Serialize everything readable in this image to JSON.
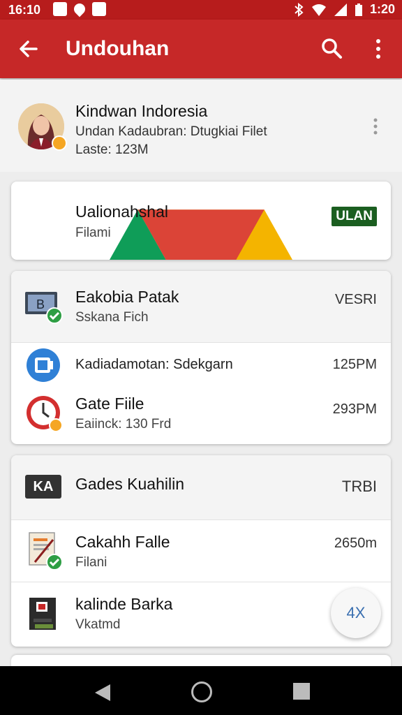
{
  "status": {
    "time": "16:10",
    "time_right": "1:20"
  },
  "appbar": {
    "title": "Undouhan"
  },
  "profile": {
    "name": "Kindwan Indoresia",
    "subtitle": "Undan Kadaubran: Dtugkiai Filet",
    "size": "Laste: 123M"
  },
  "card1": {
    "title": "Ualionahshal",
    "subtitle": "Filami",
    "badge": "ULAN"
  },
  "card2": {
    "header": {
      "title": "Eakobia Patak",
      "subtitle": "Sskana Fich",
      "right": "VESRI"
    },
    "rows": [
      {
        "title": "Kadiadamotan: Sdekgarn",
        "subtitle": "",
        "right": "125PM"
      },
      {
        "title": "Gate Fiile",
        "subtitle": "Eaiinck: 130 Frd",
        "right": "293PM"
      }
    ]
  },
  "card3": {
    "header": {
      "title": "Gades Kuahilin",
      "right": "TRBI",
      "icon_text": "KA"
    },
    "rows": [
      {
        "title": "Cakahh Falle",
        "subtitle": "Filani",
        "right": "2650m"
      },
      {
        "title": "kalinde Barka",
        "subtitle": "Vkatmd",
        "right": ""
      }
    ]
  },
  "fab": {
    "label": "4X"
  },
  "colors": {
    "primary": "#c62828",
    "status": "#b71c1c",
    "badge": "#1b5e20",
    "accent": "#3a6fb0"
  },
  "icons": [
    "back-arrow-icon",
    "search-icon",
    "more-vert-icon",
    "google-drive-icon",
    "monitor-check-icon",
    "blue-app-icon",
    "clock-icon",
    "ka-icon",
    "document-check-icon",
    "book-icon"
  ]
}
